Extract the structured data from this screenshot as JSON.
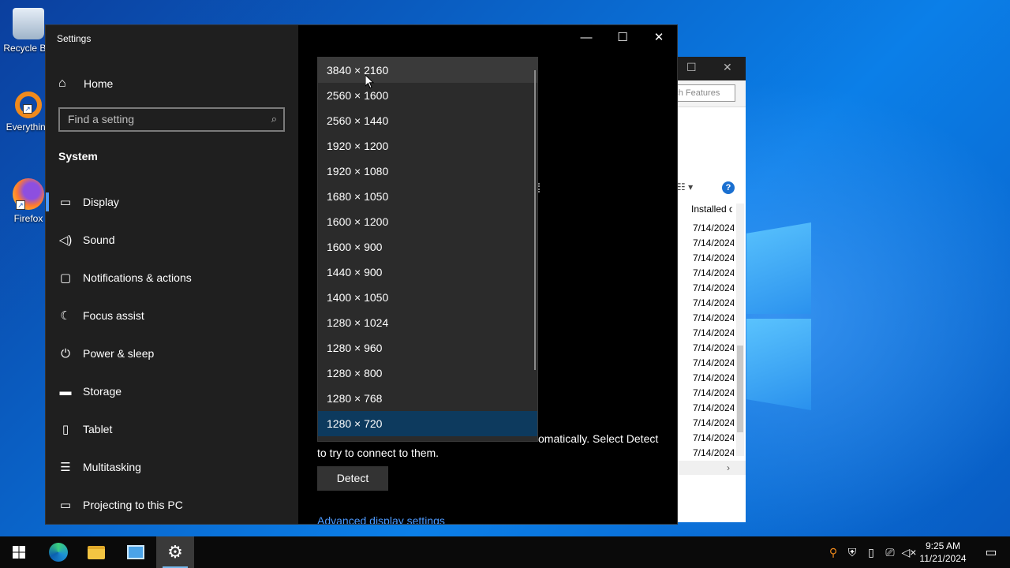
{
  "desktop": {
    "icons": [
      {
        "label": "Recycle Bin"
      },
      {
        "label": "Everything"
      },
      {
        "label": "Firefox"
      }
    ]
  },
  "background_window": {
    "search_placeholder": "Search Features",
    "column_header": "Installed on",
    "dates": [
      "7/14/2024",
      "7/14/2024",
      "7/14/2024",
      "7/14/2024",
      "7/14/2024",
      "7/14/2024",
      "7/14/2024",
      "7/14/2024",
      "7/14/2024",
      "7/14/2024",
      "7/14/2024",
      "7/14/2024",
      "7/14/2024",
      "7/14/2024",
      "7/14/2024",
      "7/14/2024"
    ],
    "help_glyph": "?"
  },
  "settings": {
    "title": "Settings",
    "home_label": "Home",
    "search_placeholder": "Find a setting",
    "section_title": "System",
    "nav": [
      {
        "label": "Display",
        "icon": "monitor-icon"
      },
      {
        "label": "Sound",
        "icon": "speaker-icon"
      },
      {
        "label": "Notifications & actions",
        "icon": "notification-icon"
      },
      {
        "label": "Focus assist",
        "icon": "moon-icon"
      },
      {
        "label": "Power & sleep",
        "icon": "power-icon"
      },
      {
        "label": "Storage",
        "icon": "storage-icon"
      },
      {
        "label": "Tablet",
        "icon": "tablet-icon"
      },
      {
        "label": "Multitasking",
        "icon": "multitasking-icon"
      },
      {
        "label": "Projecting to this PC",
        "icon": "projecting-icon"
      }
    ],
    "detect_text_end": "omatically. Select Detect",
    "detect_text_line2": "to try to connect to them.",
    "detect_button": "Detect",
    "advanced_link": "Advanced display settings"
  },
  "resolution_dropdown": {
    "options": [
      "3840 × 2160",
      "2560 × 1600",
      "2560 × 1440",
      "1920 × 1200",
      "1920 × 1080",
      "1680 × 1050",
      "1600 × 1200",
      "1600 × 900",
      "1440 × 900",
      "1400 × 1050",
      "1280 × 1024",
      "1280 × 960",
      "1280 × 800",
      "1280 × 768",
      "1280 × 720"
    ],
    "hovered": "3840 × 2160",
    "selected": "1280 × 720"
  },
  "taskbar": {
    "time": "9:25 AM",
    "date": "11/21/2024"
  },
  "colors": {
    "accent": "#4c9aff",
    "sidebar_bg": "#1f1f1f",
    "dropdown_bg": "#2b2b2b",
    "selected_bg": "#0d3a5e"
  }
}
